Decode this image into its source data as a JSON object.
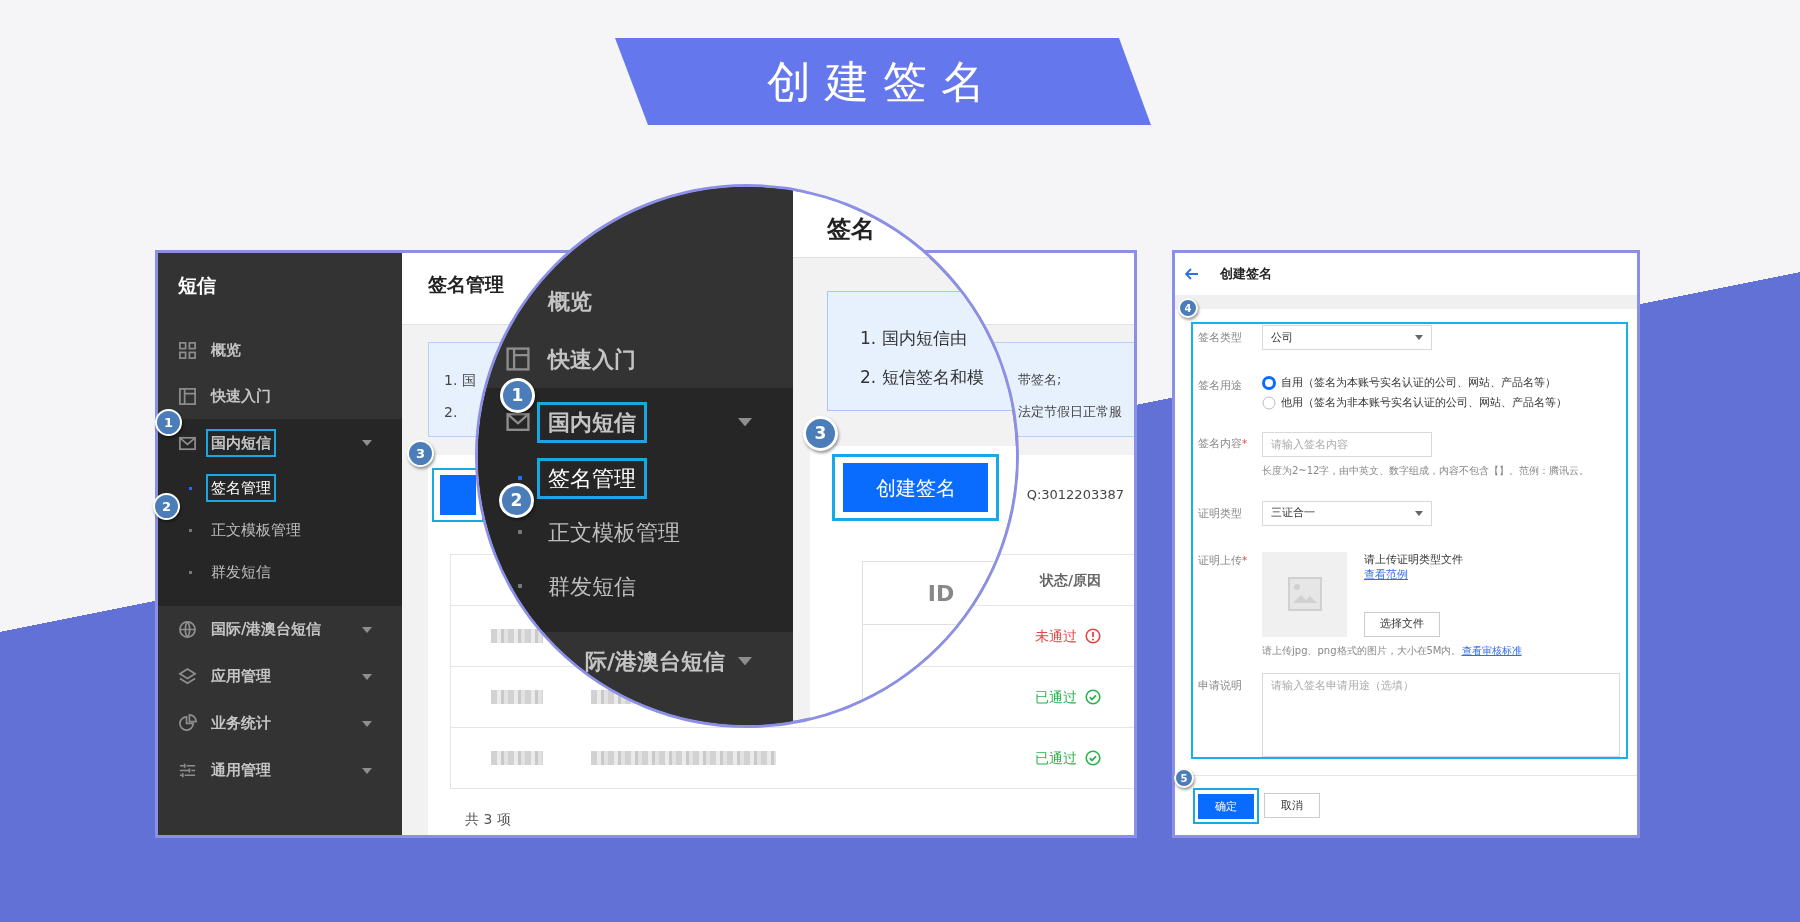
{
  "banner": {
    "title": "创建签名"
  },
  "console": {
    "sidebar": {
      "title": "短信",
      "items": [
        {
          "label": "概览",
          "selected": false
        },
        {
          "label": "快速入门",
          "selected": false
        },
        {
          "label": "国内短信",
          "selected": false,
          "expanded": true,
          "step": "1",
          "children": [
            {
              "label": "签名管理",
              "selected": true,
              "step": "2"
            },
            {
              "label": "正文模板管理",
              "selected": false
            },
            {
              "label": "群发短信",
              "selected": false
            }
          ]
        },
        {
          "label": "国际/港澳台短信",
          "selected": false,
          "expanded": false
        },
        {
          "label": "应用管理",
          "selected": false,
          "expanded": false
        },
        {
          "label": "业务统计",
          "selected": false,
          "expanded": false
        },
        {
          "label": "通用管理",
          "selected": false,
          "expanded": false
        }
      ]
    },
    "page": {
      "title": "签名管理",
      "notice_lines": [
        {
          "start": "1. 国",
          "end": "带签名;"
        },
        {
          "start": "2.",
          "end": "法定节假日正常服"
        }
      ],
      "create_step": "3",
      "contact": "Q:3012203387",
      "table": {
        "columns": [
          "状态/原因"
        ],
        "rows": [
          {
            "status": "未通过",
            "kind": "rejected"
          },
          {
            "status": "已通过",
            "kind": "approved"
          },
          {
            "status": "已通过",
            "kind": "approved"
          }
        ]
      },
      "total": "共 3 项"
    }
  },
  "magnifier": {
    "sidebar_items": [
      {
        "label": "概览",
        "selected": false
      },
      {
        "label": "快速入门",
        "selected": false
      },
      {
        "label": "国内短信",
        "selected": false,
        "expanded": true,
        "step": "1",
        "children": [
          {
            "label": "签名管理",
            "selected": true,
            "step": "2"
          },
          {
            "label": "正文模板管理",
            "selected": false
          },
          {
            "label": "群发短信",
            "selected": false
          }
        ]
      },
      {
        "label": "际/港澳台短信",
        "selected": false,
        "expanded": false
      }
    ],
    "page_title": "签名",
    "notice_lines": [
      "1. 国内短信由",
      "2. 短信签名和模"
    ],
    "create_button": {
      "label": "创建签名",
      "step": "3"
    },
    "table": {
      "columns": [
        "ID"
      ]
    }
  },
  "create_form": {
    "title": "创建签名",
    "step": "4",
    "fields": [
      {
        "kind": "select",
        "label": "签名类型",
        "value": "公司"
      },
      {
        "kind": "radio",
        "label": "签名用途",
        "options": [
          {
            "label": "自用（签名为本账号实名认证的公司、网站、产品名等）",
            "selected": true
          },
          {
            "label": "他用（签名为非本账号实名认证的公司、网站、产品名等）",
            "selected": false
          }
        ]
      },
      {
        "kind": "input",
        "label": "签名内容",
        "mark": "*",
        "placeholder": "请输入签名内容",
        "hint": "长度为2~12字，由中英文、数字组成，内容不包含【】。范例：腾讯云。"
      },
      {
        "kind": "select",
        "label": "证明类型",
        "value": "三证合一"
      },
      {
        "kind": "upload",
        "label": "证明上传",
        "mark": "*",
        "prompt": "请上传证明类型文件",
        "example_link": "查看范例",
        "button": "选择文件",
        "hint": "请上传jpg、png格式的图片，大小在5M内。",
        "hint_link": "查看审核标准"
      },
      {
        "kind": "textarea",
        "label": "申请说明",
        "placeholder": "请输入签名申请用途（选填）"
      }
    ],
    "actions_step": "5",
    "actions": [
      {
        "label": "确定",
        "primary": true
      },
      {
        "label": "取消",
        "primary": false
      }
    ]
  }
}
